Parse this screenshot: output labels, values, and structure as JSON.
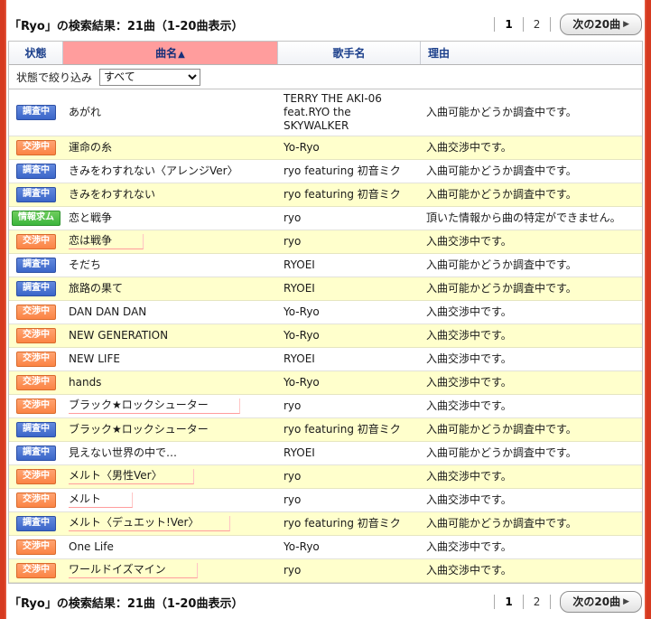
{
  "page": {
    "results_summary": "「Ryo」の検索結果：21曲（1-20曲表示）"
  },
  "pagination": {
    "page1": "1",
    "page2": "2",
    "next_label": "次の20曲",
    "next_icon": "▶"
  },
  "filter": {
    "label": "状態で絞り込み",
    "selected": "すべて"
  },
  "table": {
    "headers": {
      "status": "状態",
      "title": "曲名",
      "sort_icon": "▲",
      "artist": "歌手名",
      "reason": "理由"
    },
    "status_legend": {
      "investigating": "調査中",
      "negotiating": "交渉中",
      "info_wanted": "情報求ム"
    },
    "rows": [
      {
        "status": "調査中",
        "badge": "blue",
        "title": "あがれ",
        "link": false,
        "artist": "TERRY THE AKI-06 feat.RYO the SKYWALKER",
        "reason": "入曲可能かどうか調査中です。"
      },
      {
        "status": "交渉中",
        "badge": "orange",
        "title": "運命の糸",
        "link": false,
        "artist": "Yo-Ryo",
        "reason": "入曲交渉中です。"
      },
      {
        "status": "調査中",
        "badge": "blue",
        "title": "きみをわすれない〈アレンジVer〉",
        "link": false,
        "artist": "ryo featuring 初音ミク",
        "reason": "入曲可能かどうか調査中です。"
      },
      {
        "status": "調査中",
        "badge": "blue",
        "title": "きみをわすれない",
        "link": false,
        "artist": "ryo featuring 初音ミク",
        "reason": "入曲可能かどうか調査中です。"
      },
      {
        "status": "情報求ム",
        "badge": "green",
        "title": "恋と戦争",
        "link": false,
        "artist": "ryo",
        "reason": "頂いた情報から曲の特定ができません。"
      },
      {
        "status": "交渉中",
        "badge": "orange",
        "title": "恋は戦争",
        "link": true,
        "artist": "ryo",
        "reason": "入曲交渉中です。"
      },
      {
        "status": "調査中",
        "badge": "blue",
        "title": "そだち",
        "link": false,
        "artist": "RYOEI",
        "reason": "入曲可能かどうか調査中です。"
      },
      {
        "status": "調査中",
        "badge": "blue",
        "title": "旅路の果て",
        "link": false,
        "artist": "RYOEI",
        "reason": "入曲可能かどうか調査中です。"
      },
      {
        "status": "交渉中",
        "badge": "orange",
        "title": "DAN DAN DAN",
        "link": false,
        "artist": "Yo-Ryo",
        "reason": "入曲交渉中です。"
      },
      {
        "status": "交渉中",
        "badge": "orange",
        "title": "NEW GENERATION",
        "link": false,
        "artist": "Yo-Ryo",
        "reason": "入曲交渉中です。"
      },
      {
        "status": "交渉中",
        "badge": "orange",
        "title": "NEW LIFE",
        "link": false,
        "artist": "RYOEI",
        "reason": "入曲交渉中です。"
      },
      {
        "status": "交渉中",
        "badge": "orange",
        "title": "hands",
        "link": false,
        "artist": "Yo-Ryo",
        "reason": "入曲交渉中です。"
      },
      {
        "status": "交渉中",
        "badge": "orange",
        "title": "ブラック★ロックシューター",
        "link": true,
        "artist": "ryo",
        "reason": "入曲交渉中です。"
      },
      {
        "status": "調査中",
        "badge": "blue",
        "title": "ブラック★ロックシューター",
        "link": false,
        "artist": "ryo featuring 初音ミク",
        "reason": "入曲可能かどうか調査中です。"
      },
      {
        "status": "調査中",
        "badge": "blue",
        "title": "見えない世界の中で…",
        "link": false,
        "artist": "RYOEI",
        "reason": "入曲可能かどうか調査中です。"
      },
      {
        "status": "交渉中",
        "badge": "orange",
        "title": "メルト〈男性Ver〉",
        "link": true,
        "artist": "ryo",
        "reason": "入曲交渉中です。"
      },
      {
        "status": "交渉中",
        "badge": "orange",
        "title": "メルト",
        "link": true,
        "artist": "ryo",
        "reason": "入曲交渉中です。"
      },
      {
        "status": "調査中",
        "badge": "blue",
        "title": "メルト〈デュエット!Ver〉",
        "link": true,
        "artist": "ryo featuring 初音ミク",
        "reason": "入曲可能かどうか調査中です。"
      },
      {
        "status": "交渉中",
        "badge": "orange",
        "title": "One Life",
        "link": false,
        "artist": "Yo-Ryo",
        "reason": "入曲交渉中です。"
      },
      {
        "status": "交渉中",
        "badge": "orange",
        "title": "ワールドイズマイン",
        "link": true,
        "artist": "ryo",
        "reason": "入曲交渉中です。"
      }
    ]
  },
  "colors": {
    "frame_red": "#d63a20",
    "badge_blue": "#3b66c9",
    "badge_orange": "#fb8444",
    "badge_green": "#3cb53c",
    "row_alt": "#ffffcc",
    "header_active": "#ff9d9d"
  }
}
